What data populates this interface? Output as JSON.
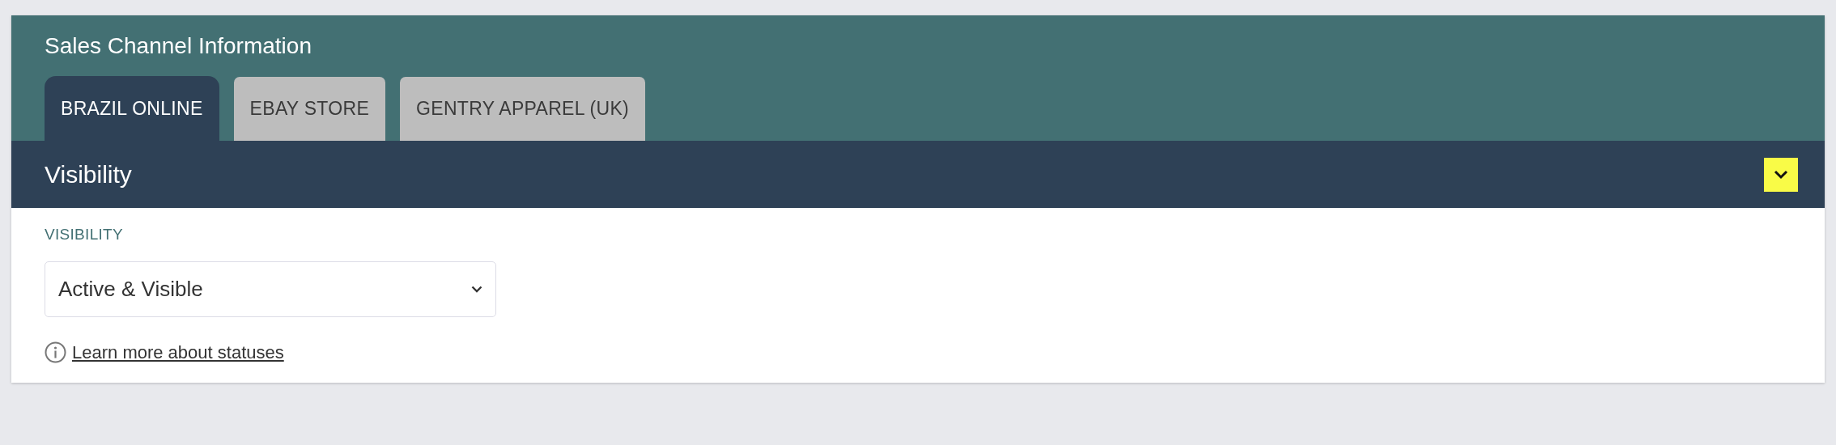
{
  "card": {
    "title": "Sales Channel Information"
  },
  "tabs": [
    {
      "label": "BRAZIL ONLINE",
      "selected": true
    },
    {
      "label": "EBAY STORE",
      "selected": false
    },
    {
      "label": "GENTRY APPAREL (UK)",
      "selected": false
    }
  ],
  "section": {
    "title": "Visibility",
    "expanded": true,
    "field": {
      "label": "VISIBILITY",
      "value": "Active & Visible"
    },
    "help_link": "Learn more about statuses"
  }
}
